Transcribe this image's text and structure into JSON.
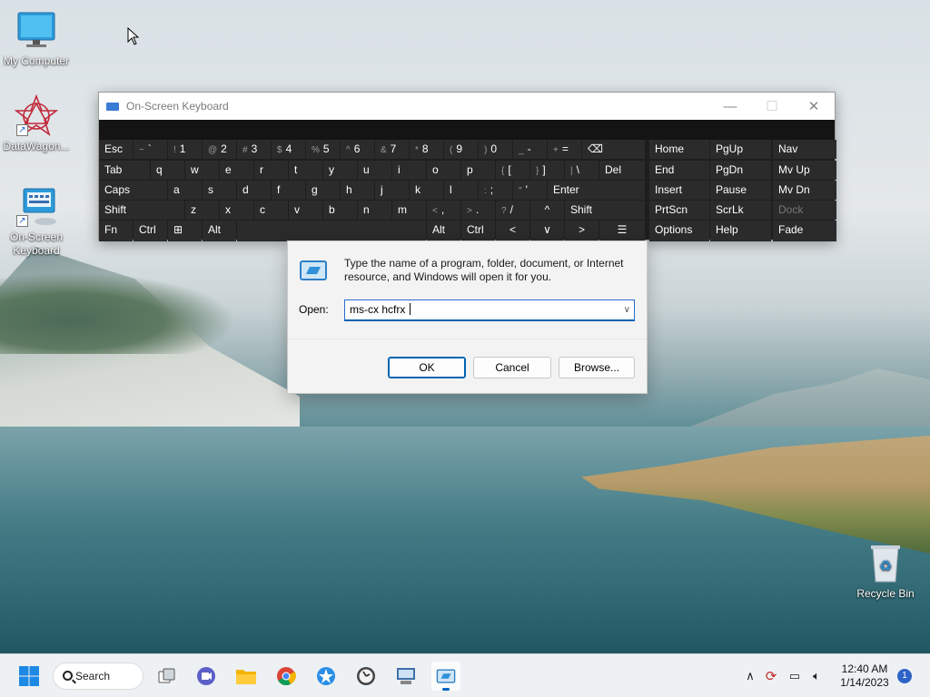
{
  "desktop": {
    "icons": [
      {
        "label": "My Computer"
      },
      {
        "label": "DataWagon..."
      },
      {
        "label": "On-Screen Keyboard"
      },
      {
        "label": "Recycle Bin"
      }
    ]
  },
  "osk": {
    "title": "On-Screen Keyboard",
    "rows": {
      "r1": [
        {
          "main": "Esc"
        },
        {
          "sub": "~",
          "main": "`"
        },
        {
          "sub": "!",
          "main": "1"
        },
        {
          "sub": "@",
          "main": "2"
        },
        {
          "sub": "#",
          "main": "3"
        },
        {
          "sub": "$",
          "main": "4"
        },
        {
          "sub": "%",
          "main": "5"
        },
        {
          "sub": "^",
          "main": "6"
        },
        {
          "sub": "&",
          "main": "7"
        },
        {
          "sub": "*",
          "main": "8"
        },
        {
          "sub": "(",
          "main": "9"
        },
        {
          "sub": ")",
          "main": "0"
        },
        {
          "sub": "_",
          "main": "-"
        },
        {
          "sub": "+",
          "main": "="
        },
        {
          "main": "⌫"
        },
        {
          "main": "Home"
        },
        {
          "main": "PgUp"
        },
        {
          "main": "Nav"
        }
      ],
      "r2": [
        {
          "main": "Tab"
        },
        {
          "main": "q"
        },
        {
          "main": "w"
        },
        {
          "main": "e"
        },
        {
          "main": "r"
        },
        {
          "main": "t"
        },
        {
          "main": "y"
        },
        {
          "main": "u"
        },
        {
          "main": "i"
        },
        {
          "main": "o"
        },
        {
          "main": "p"
        },
        {
          "sub": "{",
          "main": "["
        },
        {
          "sub": "}",
          "main": "]"
        },
        {
          "sub": "|",
          "main": "\\"
        },
        {
          "main": "Del"
        },
        {
          "main": "End"
        },
        {
          "main": "PgDn"
        },
        {
          "main": "Mv Up"
        }
      ],
      "r3": [
        {
          "main": "Caps"
        },
        {
          "main": "a"
        },
        {
          "main": "s"
        },
        {
          "main": "d"
        },
        {
          "main": "f"
        },
        {
          "main": "g"
        },
        {
          "main": "h"
        },
        {
          "main": "j"
        },
        {
          "main": "k"
        },
        {
          "main": "l"
        },
        {
          "sub": ":",
          "main": ";"
        },
        {
          "sub": "\"",
          "main": "'"
        },
        {
          "main": "Enter"
        },
        {
          "main": "Insert"
        },
        {
          "main": "Pause"
        },
        {
          "main": "Mv Dn"
        }
      ],
      "r4": [
        {
          "main": "Shift"
        },
        {
          "main": "z"
        },
        {
          "main": "x"
        },
        {
          "main": "c"
        },
        {
          "main": "v"
        },
        {
          "main": "b"
        },
        {
          "main": "n"
        },
        {
          "main": "m"
        },
        {
          "sub": "<",
          "main": ","
        },
        {
          "sub": ">",
          "main": "."
        },
        {
          "sub": "?",
          "main": "/"
        },
        {
          "main": "^"
        },
        {
          "main": "Shift"
        },
        {
          "main": "PrtScn"
        },
        {
          "main": "ScrLk"
        },
        {
          "main": "Dock"
        }
      ],
      "r5": [
        {
          "main": "Fn"
        },
        {
          "main": "Ctrl"
        },
        {
          "main": "⊞"
        },
        {
          "main": "Alt"
        },
        {
          "main": ""
        },
        {
          "main": "Alt"
        },
        {
          "main": "Ctrl"
        },
        {
          "main": "<"
        },
        {
          "main": "∨"
        },
        {
          "main": ">"
        },
        {
          "main": "☰"
        },
        {
          "main": "Options"
        },
        {
          "main": "Help"
        },
        {
          "main": "Fade"
        }
      ]
    }
  },
  "run": {
    "description": "Type the name of a program, folder, document, or Internet resource, and Windows will open it for you.",
    "open_label": "Open:",
    "input_value": "ms-cx hcfrx ",
    "ok_label": "OK",
    "cancel_label": "Cancel",
    "browse_label": "Browse..."
  },
  "taskbar": {
    "search_label": "Search",
    "time": "12:40 AM",
    "date": "1/14/2023",
    "notification_count": "1"
  }
}
